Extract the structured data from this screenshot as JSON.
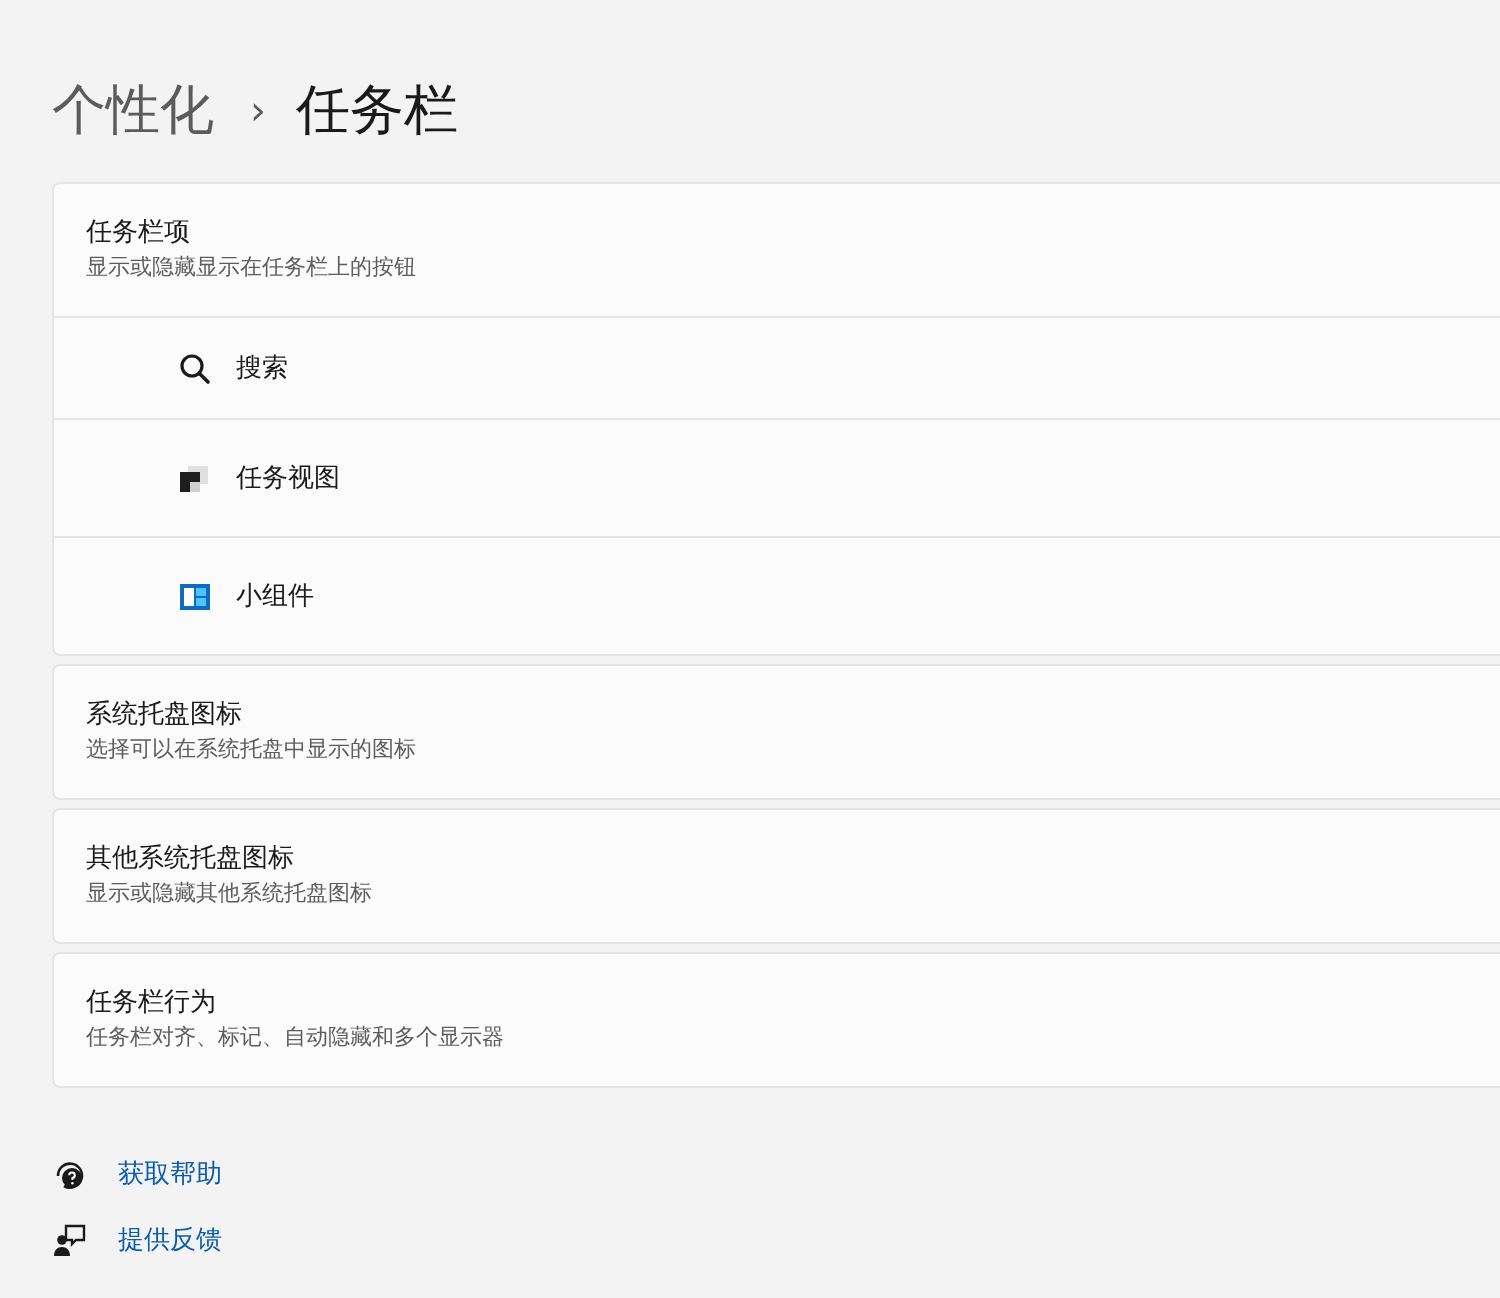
{
  "breadcrumb": {
    "parent": "个性化",
    "separator": "›",
    "current": "任务栏"
  },
  "sections": [
    {
      "title": "任务栏项",
      "subtitle": "显示或隐藏显示在任务栏上的按钮",
      "items": [
        {
          "kind": "search",
          "label": "搜索"
        },
        {
          "kind": "taskview",
          "label": "任务视图"
        },
        {
          "kind": "widgets",
          "label": "小组件"
        }
      ]
    },
    {
      "title": "系统托盘图标",
      "subtitle": "选择可以在系统托盘中显示的图标"
    },
    {
      "title": "其他系统托盘图标",
      "subtitle": "显示或隐藏其他系统托盘图标"
    },
    {
      "title": "任务栏行为",
      "subtitle": "任务栏对齐、标记、自动隐藏和多个显示器"
    }
  ],
  "links": [
    {
      "kind": "help",
      "label": "获取帮助"
    },
    {
      "kind": "feedback",
      "label": "提供反馈"
    }
  ]
}
